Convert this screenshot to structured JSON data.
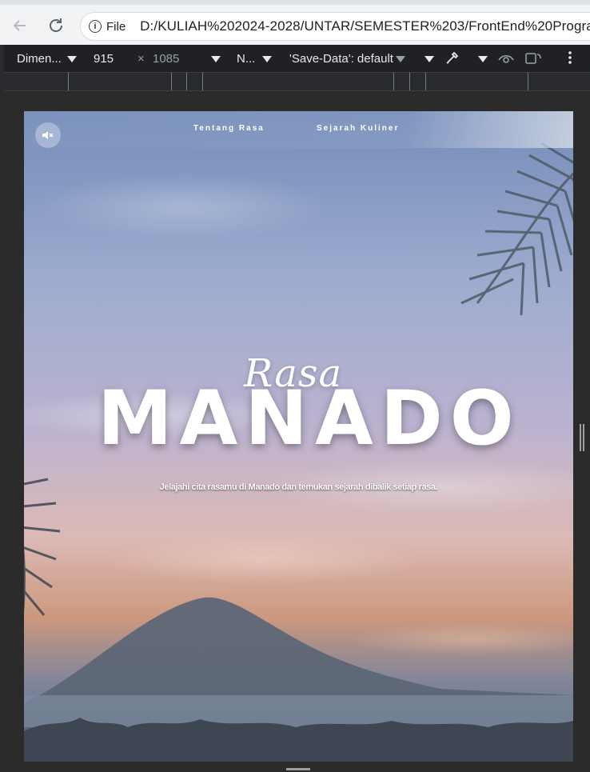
{
  "browser": {
    "file_label": "File",
    "url": "D:/KULIAH%202024-2028/UNTAR/SEMESTER%203/FrontEnd%20Program"
  },
  "devtools": {
    "dimensions_label": "Dimen...",
    "width": "915",
    "times": "×",
    "height": "1085",
    "network_label": "N...",
    "save_data_label": "'Save-Data': default"
  },
  "page": {
    "nav": [
      {
        "label": "Tentang Rasa"
      },
      {
        "label": "Sejarah Kuliner"
      }
    ],
    "hero": {
      "script_title": "Rasa",
      "title": "MANADO",
      "subtitle": "Jelajahi cita rasamu di Manado dan temukan sejarah dibalik setiap rasa."
    }
  },
  "icons": {
    "mute": "mute-speaker-icon",
    "back": "back-arrow-icon",
    "reload": "reload-icon",
    "info": "info-icon"
  }
}
